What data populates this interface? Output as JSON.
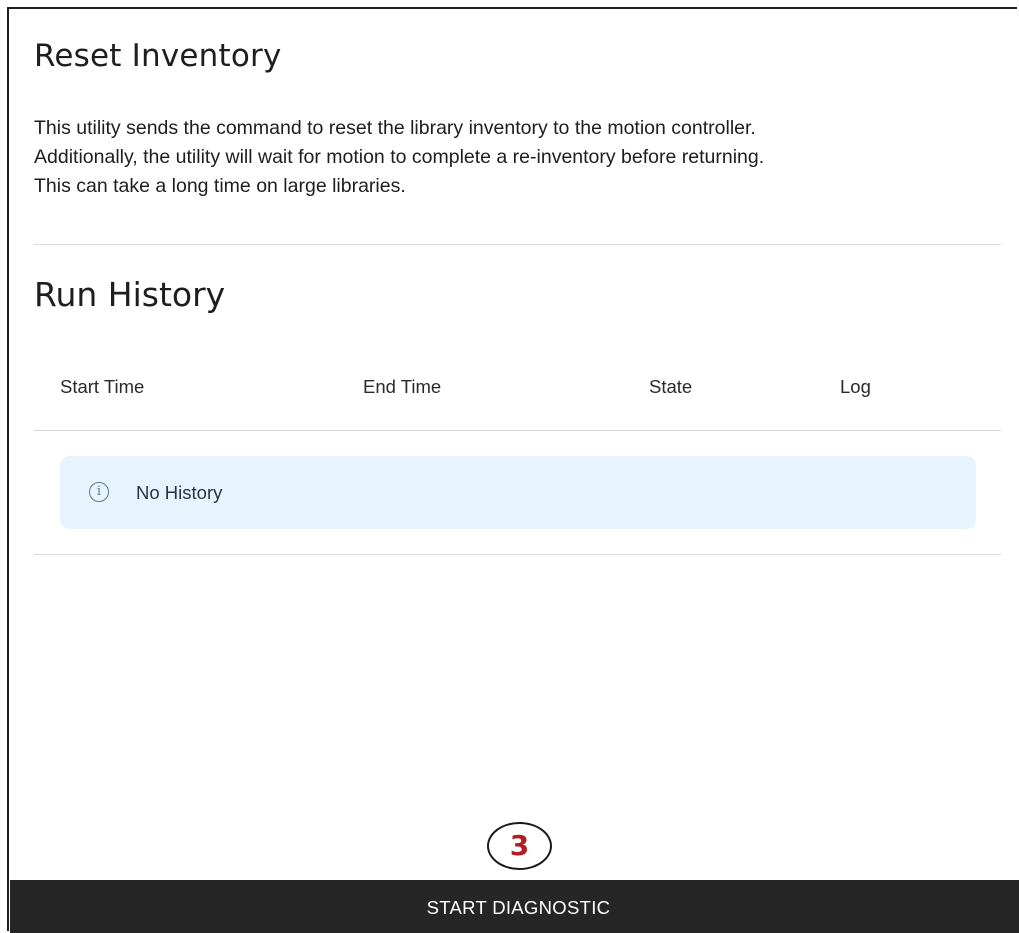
{
  "page": {
    "title": "Reset Inventory",
    "description_lines": [
      "This utility sends the command to reset the library inventory to the motion controller.",
      "Additionally, the utility will wait for motion to complete a re-inventory before returning.",
      "This can take a long time on large libraries."
    ]
  },
  "history": {
    "heading": "Run History",
    "columns": [
      "Start Time",
      "End Time",
      "State",
      "Log"
    ],
    "empty_message": "No History",
    "empty_icon": "info-circle-icon"
  },
  "annotation": {
    "callout_number": "3",
    "callout_color": "#b01e23"
  },
  "footer": {
    "start_button_label": "START DIAGNOSTIC",
    "button_color": "#262626"
  }
}
